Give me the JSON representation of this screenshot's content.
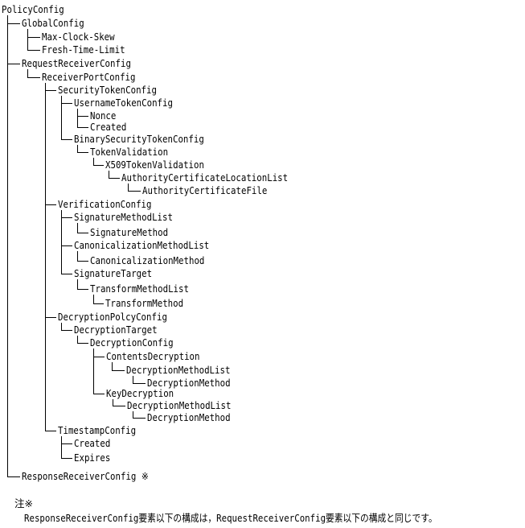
{
  "tree": {
    "label": "PolicyConfig",
    "children": [
      {
        "label": "GlobalConfig",
        "children": [
          {
            "label": "Max-Clock-Skew"
          },
          {
            "label": "Fresh-Time-Limit"
          }
        ]
      },
      {
        "label": "RequestReceiverConfig",
        "children": [
          {
            "label": "ReceiverPortConfig",
            "children": [
              {
                "label": "SecurityTokenConfig",
                "children": [
                  {
                    "label": "UsernameTokenConfig",
                    "children": [
                      {
                        "label": "Nonce"
                      },
                      {
                        "label": "Created"
                      }
                    ]
                  },
                  {
                    "label": "BinarySecurityTokenConfig",
                    "children": [
                      {
                        "label": "TokenValidation",
                        "children": [
                          {
                            "label": "X509TokenValidation",
                            "children": [
                              {
                                "label": "AuthorityCertificateLocationList",
                                "children": [
                                  {
                                    "label": "AuthorityCertificateFile"
                                  }
                                ]
                              }
                            ]
                          }
                        ]
                      }
                    ]
                  }
                ]
              },
              {
                "label": "VerificationConfig",
                "children": [
                  {
                    "label": "SignatureMethodList",
                    "children": [
                      {
                        "label": "SignatureMethod"
                      }
                    ]
                  },
                  {
                    "label": "CanonicalizationMethodList",
                    "children": [
                      {
                        "label": "CanonicalizationMethod"
                      }
                    ]
                  },
                  {
                    "label": "SignatureTarget",
                    "children": [
                      {
                        "label": "TransformMethodList",
                        "children": [
                          {
                            "label": "TransformMethod"
                          }
                        ]
                      }
                    ]
                  }
                ]
              },
              {
                "label": "DecryptionPolcyConfig",
                "children": [
                  {
                    "label": "DecryptionTarget",
                    "children": [
                      {
                        "label": "DecryptionConfig",
                        "children": [
                          {
                            "label": "ContentsDecryption",
                            "children": [
                              {
                                "label": "DecryptionMethodList",
                                "children": [
                                  {
                                    "label": "DecryptionMethod"
                                  }
                                ]
                              }
                            ]
                          },
                          {
                            "label": "KeyDecryption",
                            "children": [
                              {
                                "label": "DecryptionMethodList",
                                "children": [
                                  {
                                    "label": "DecryptionMethod"
                                  }
                                ]
                              }
                            ]
                          }
                        ]
                      }
                    ]
                  }
                ]
              },
              {
                "label": "TimestampConfig",
                "children": [
                  {
                    "label": "Created"
                  },
                  {
                    "label": "Expires"
                  }
                ]
              }
            ]
          }
        ]
      },
      {
        "label": "ResponseReceiverConfig  ※"
      }
    ]
  },
  "note": {
    "title": "注※",
    "body": "ResponseReceiverConfig要素以下の構成は，RequestReceiverConfig要素以下の構成と同じです。"
  }
}
